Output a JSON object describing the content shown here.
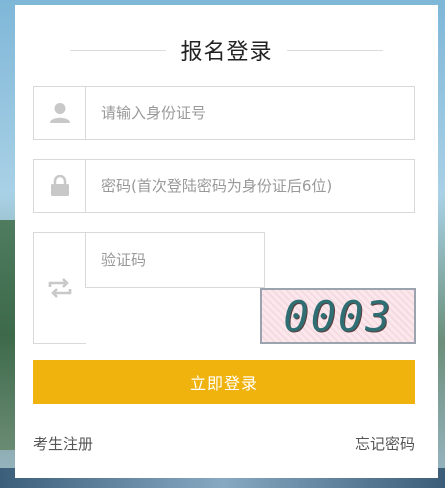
{
  "header": {
    "title": "报名登录"
  },
  "form": {
    "id_number": {
      "placeholder": "请输入身份证号",
      "icon": "user-icon"
    },
    "password": {
      "placeholder": "密码(首次登陆密码为身份证后6位)",
      "icon": "lock-icon"
    },
    "captcha": {
      "placeholder": "验证码",
      "icon": "refresh-icon",
      "image_text": "0003"
    },
    "submit_label": "立即登录"
  },
  "footer": {
    "register_label": "考生注册",
    "forgot_label": "忘记密码"
  },
  "colors": {
    "accent": "#f0b30d",
    "border": "#d9d9d9",
    "icon": "#c8c8c8"
  }
}
